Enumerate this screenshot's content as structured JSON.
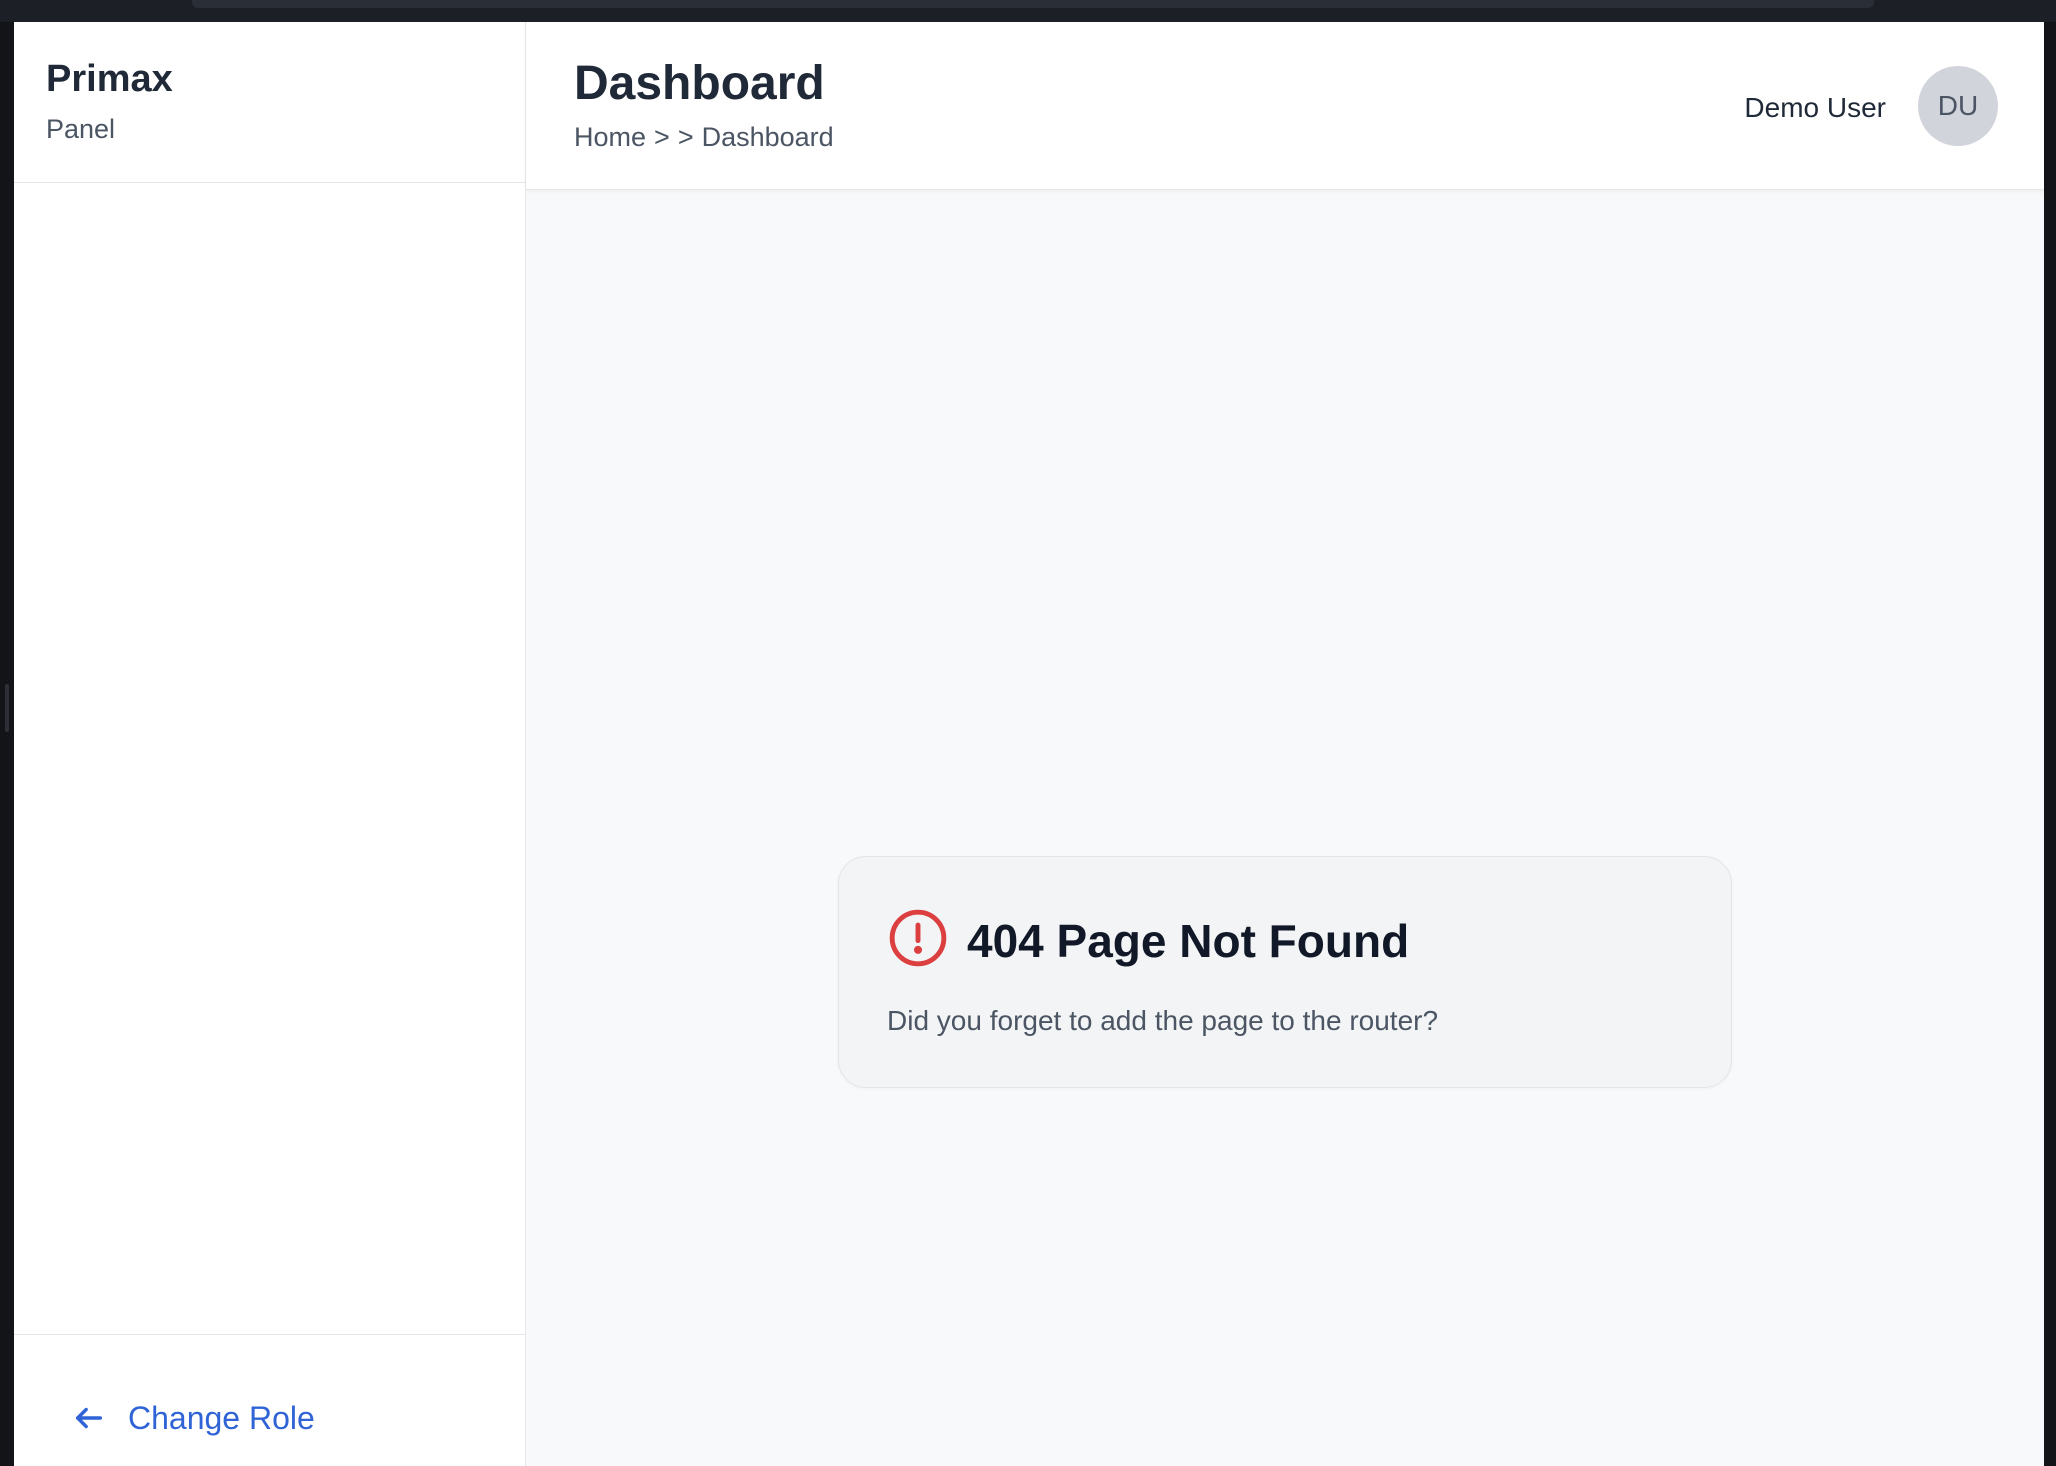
{
  "sidebar": {
    "brand_name": "Primax",
    "brand_subtitle": "Panel",
    "footer": {
      "change_role_label": "Change Role",
      "change_role_icon": "arrow-left-icon"
    }
  },
  "header": {
    "title": "Dashboard",
    "breadcrumb": {
      "home": "Home",
      "sep1": ">",
      "sep2": ">",
      "current": "Dashboard"
    },
    "user": {
      "name": "Demo User",
      "initials": "DU"
    }
  },
  "error": {
    "icon": "alert-circle-icon",
    "title": "404 Page Not Found",
    "description": "Did you forget to add the page to the router?"
  },
  "colors": {
    "accent": "#2f63d6",
    "error_icon": "#dc3f3f",
    "text_primary": "#1f2937",
    "text_secondary": "#4b5563",
    "avatar_bg": "#d1d5db"
  }
}
